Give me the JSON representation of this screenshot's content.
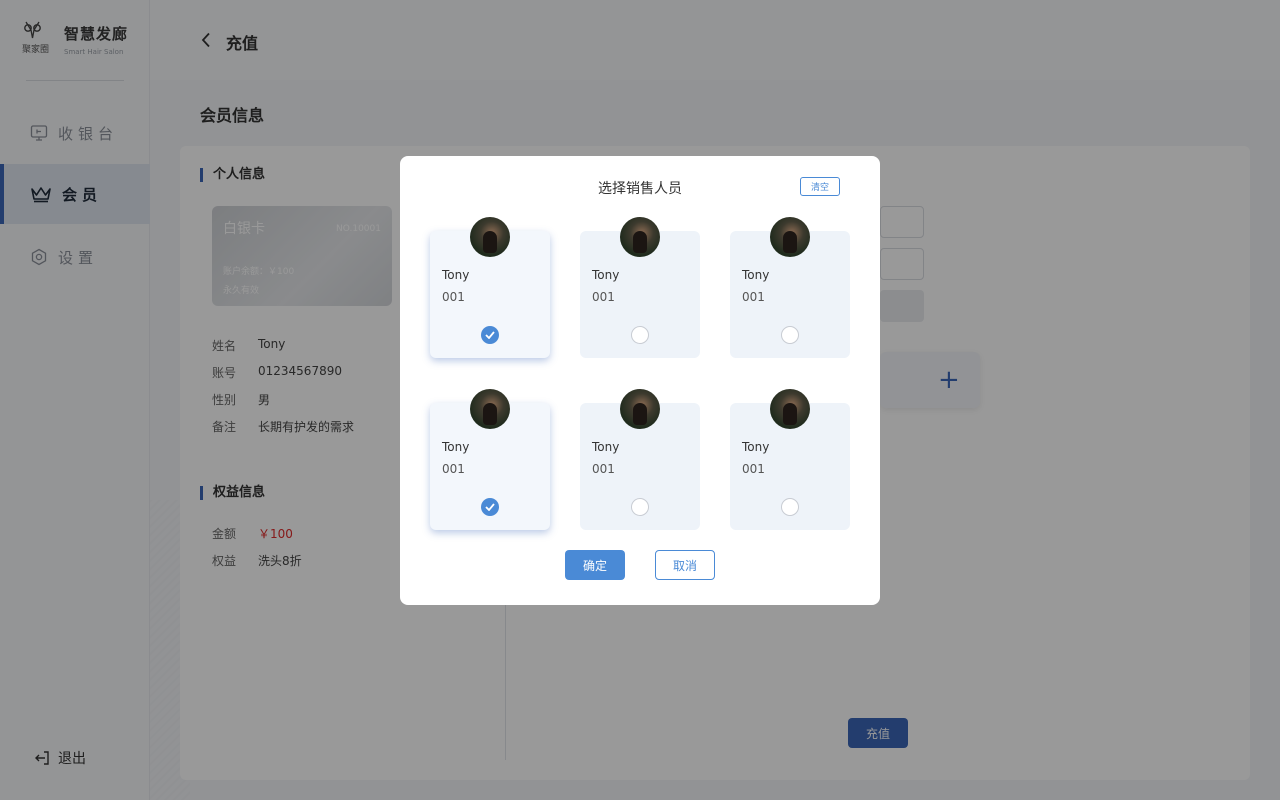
{
  "brand": {
    "logo_text": "聚家圈",
    "title": "智慧发廊",
    "subtitle": "Smart Hair Salon"
  },
  "sidebar": {
    "items": [
      {
        "label": "收银台",
        "icon": "cashier-icon"
      },
      {
        "label": "会员",
        "icon": "crown-icon"
      },
      {
        "label": "设置",
        "icon": "gear-icon"
      }
    ],
    "logout_label": "退出"
  },
  "header": {
    "title": "充值"
  },
  "page": {
    "section_title": "会员信息",
    "personal_title": "个人信息",
    "card": {
      "name": "白银卡",
      "number": "NO.10001",
      "balance": "账户余额：￥100",
      "validity": "永久有效"
    },
    "info": [
      {
        "key": "姓名",
        "value": "Tony"
      },
      {
        "key": "账号",
        "value": "01234567890"
      },
      {
        "key": "性别",
        "value": "男"
      },
      {
        "key": "备注",
        "value": "长期有护发的需求"
      }
    ],
    "rights_title": "权益信息",
    "rights": [
      {
        "key": "金额",
        "value": "￥100"
      },
      {
        "key": "权益",
        "value": "洗头8折"
      }
    ],
    "charge_button": "充值",
    "accent_color": "#3b67b8",
    "price_color": "#e02a2a"
  },
  "modal": {
    "title": "选择销售人员",
    "clear_label": "清空",
    "staff": [
      {
        "name": "Tony",
        "id": "001",
        "selected": true
      },
      {
        "name": "Tony",
        "id": "001",
        "selected": false
      },
      {
        "name": "Tony",
        "id": "001",
        "selected": false
      },
      {
        "name": "Tony",
        "id": "001",
        "selected": true
      },
      {
        "name": "Tony",
        "id": "001",
        "selected": false
      },
      {
        "name": "Tony",
        "id": "001",
        "selected": false
      }
    ],
    "confirm_label": "确定",
    "cancel_label": "取消",
    "check_color": "#4a8ad6"
  }
}
